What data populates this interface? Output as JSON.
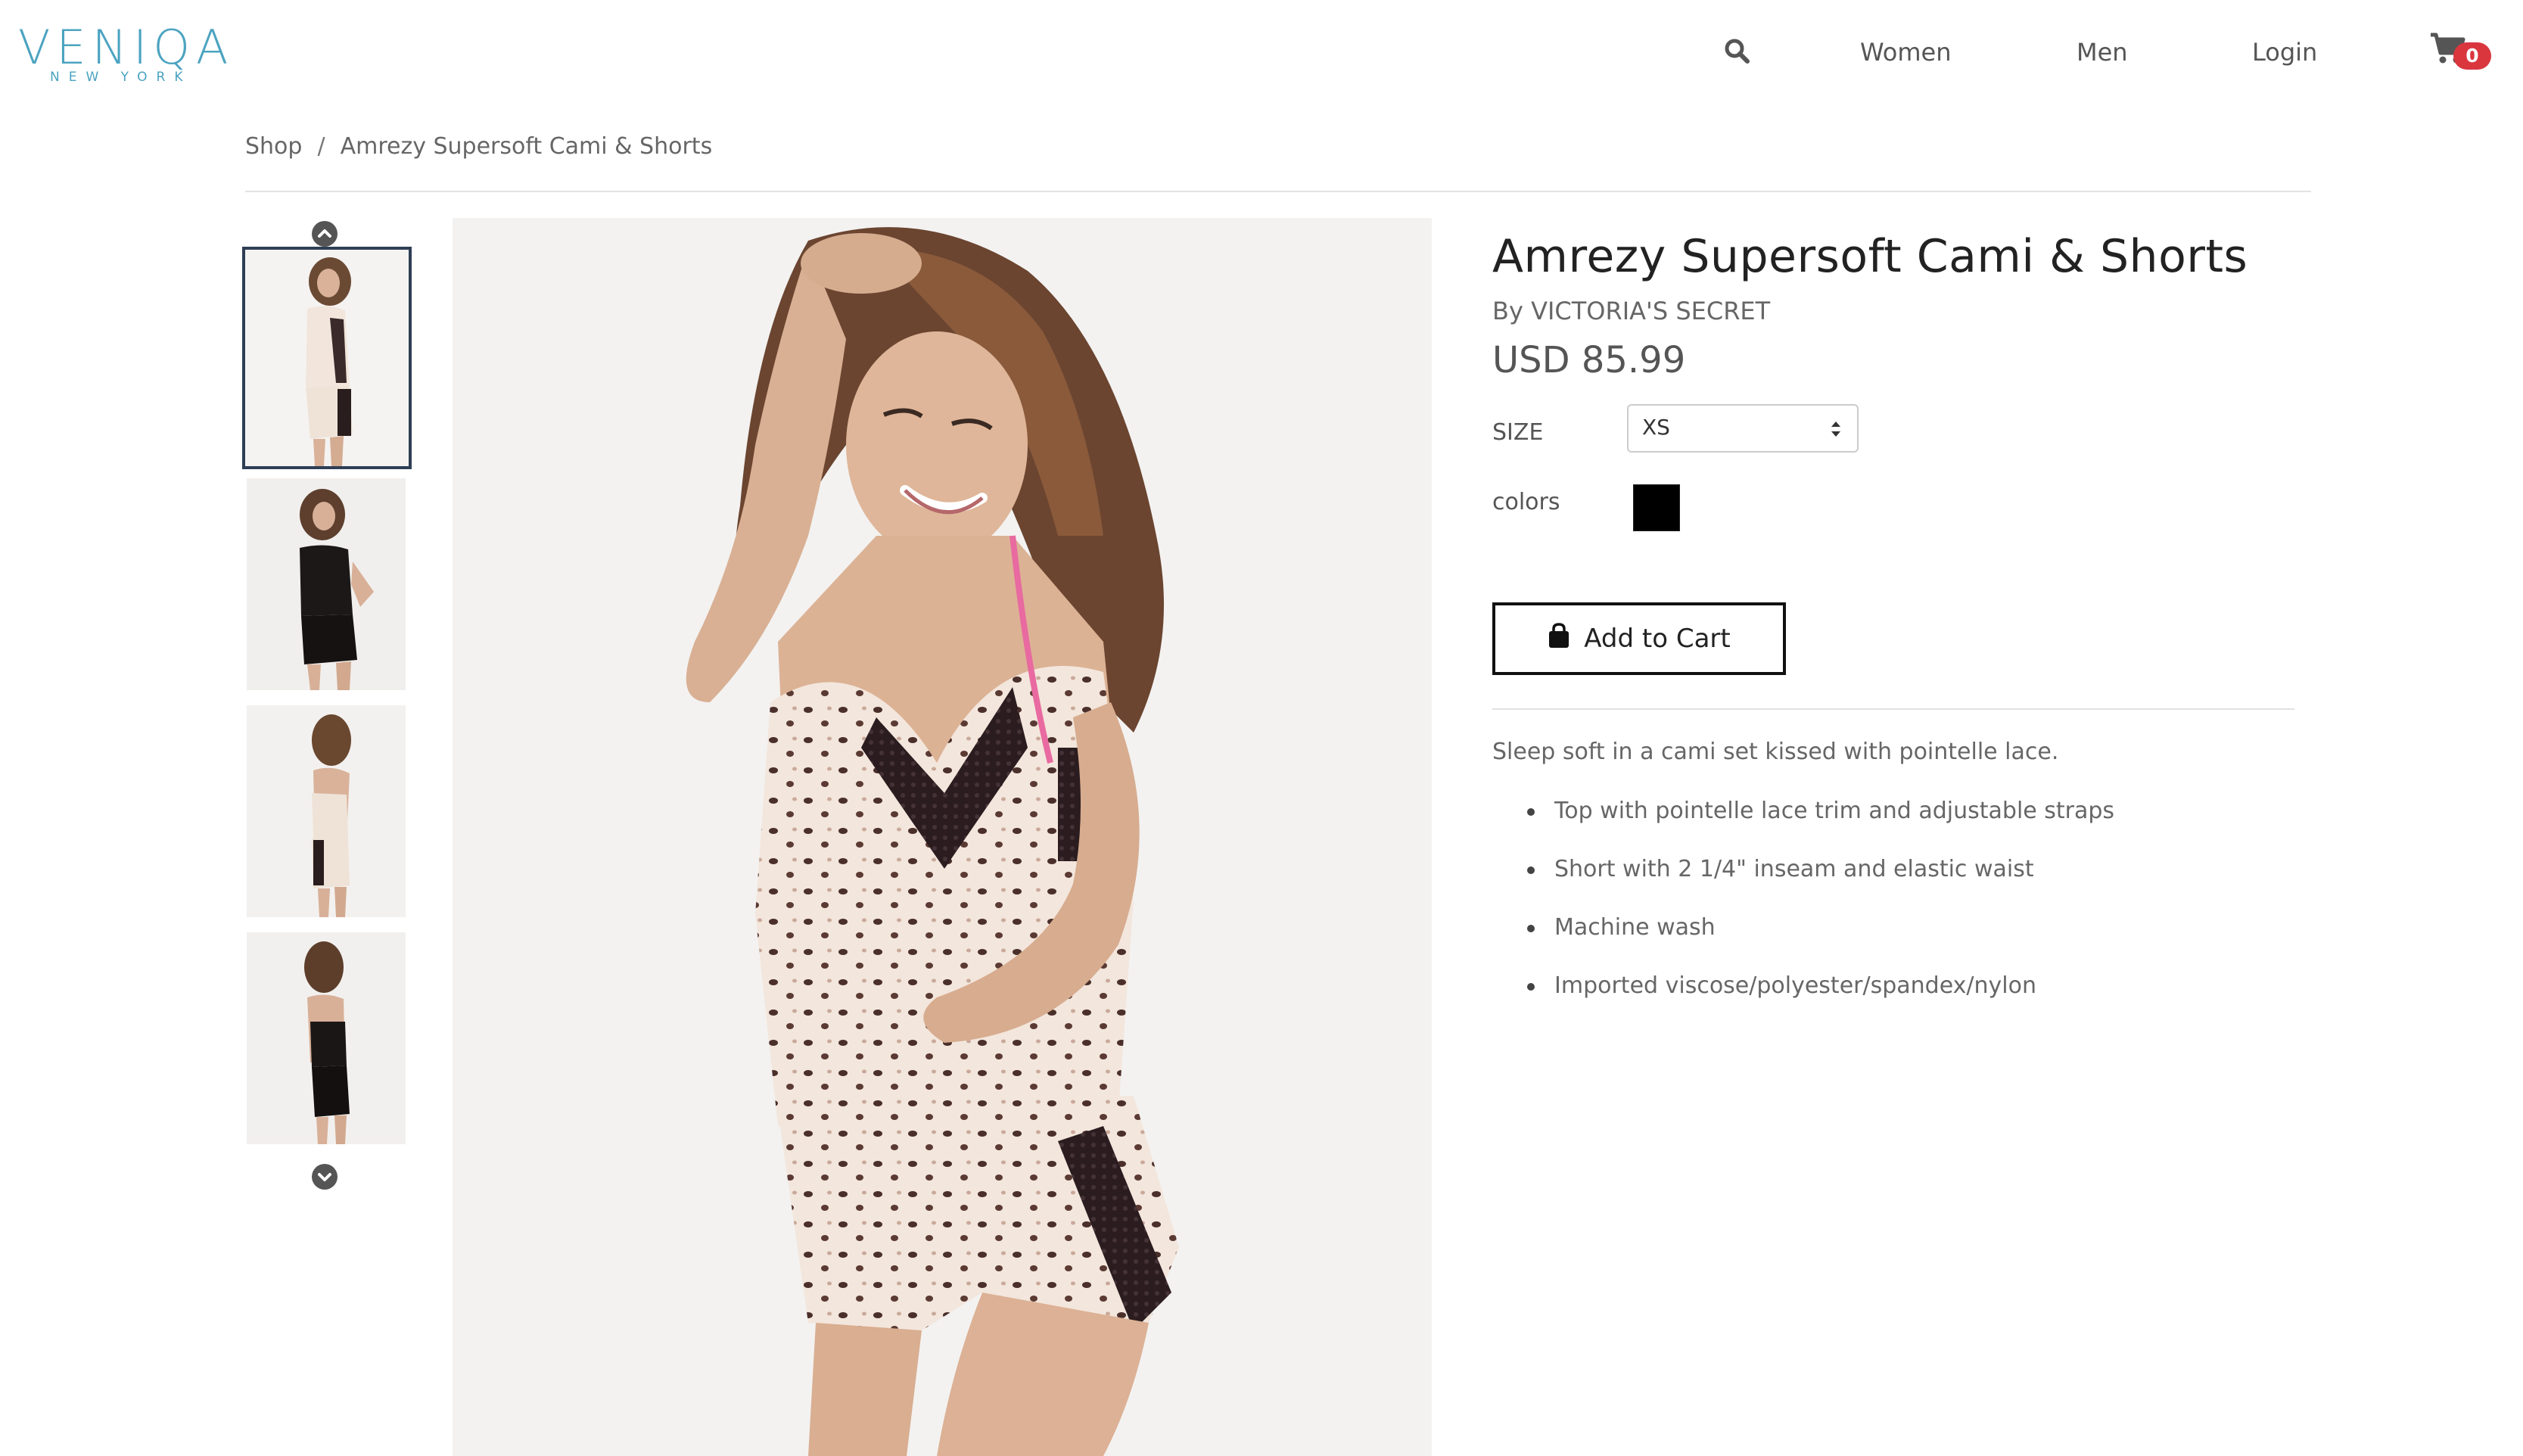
{
  "header": {
    "logo_main": "VENIQA",
    "logo_sub": "NEW YORK",
    "nav": {
      "women": "Women",
      "men": "Men",
      "login": "Login"
    },
    "cart_count": "0"
  },
  "breadcrumb": {
    "shop": "Shop",
    "separator": "/",
    "current": "Amrezy Supersoft Cami & Shorts"
  },
  "product": {
    "title": "Amrezy Supersoft Cami & Shorts",
    "brand": "By VICTORIA'S SECRET",
    "price": "USD 85.99",
    "size_label": "SIZE",
    "size_value": "XS",
    "colors_label": "colors",
    "swatch_color": "#000000",
    "add_to_cart": "Add to Cart",
    "description": "Sleep soft in a cami set kissed with pointelle lace.",
    "features": [
      "Top with pointelle lace trim and adjustable straps",
      "Short with 2 1/4\" inseam and elastic waist",
      "Machine wash",
      "Imported viscose/polyester/spandex/nylon"
    ]
  },
  "icons": {
    "search": "search-icon",
    "cart": "cart-icon",
    "thumb_up": "chevron-up-icon",
    "thumb_down": "chevron-down-icon",
    "bag": "shopping-bag-icon",
    "select_caret": "select-caret-icon"
  },
  "colors": {
    "brand": "#4ba3c0",
    "badge": "#d9363e",
    "text": "#555555",
    "selected_thumb": "#2e3e55"
  }
}
